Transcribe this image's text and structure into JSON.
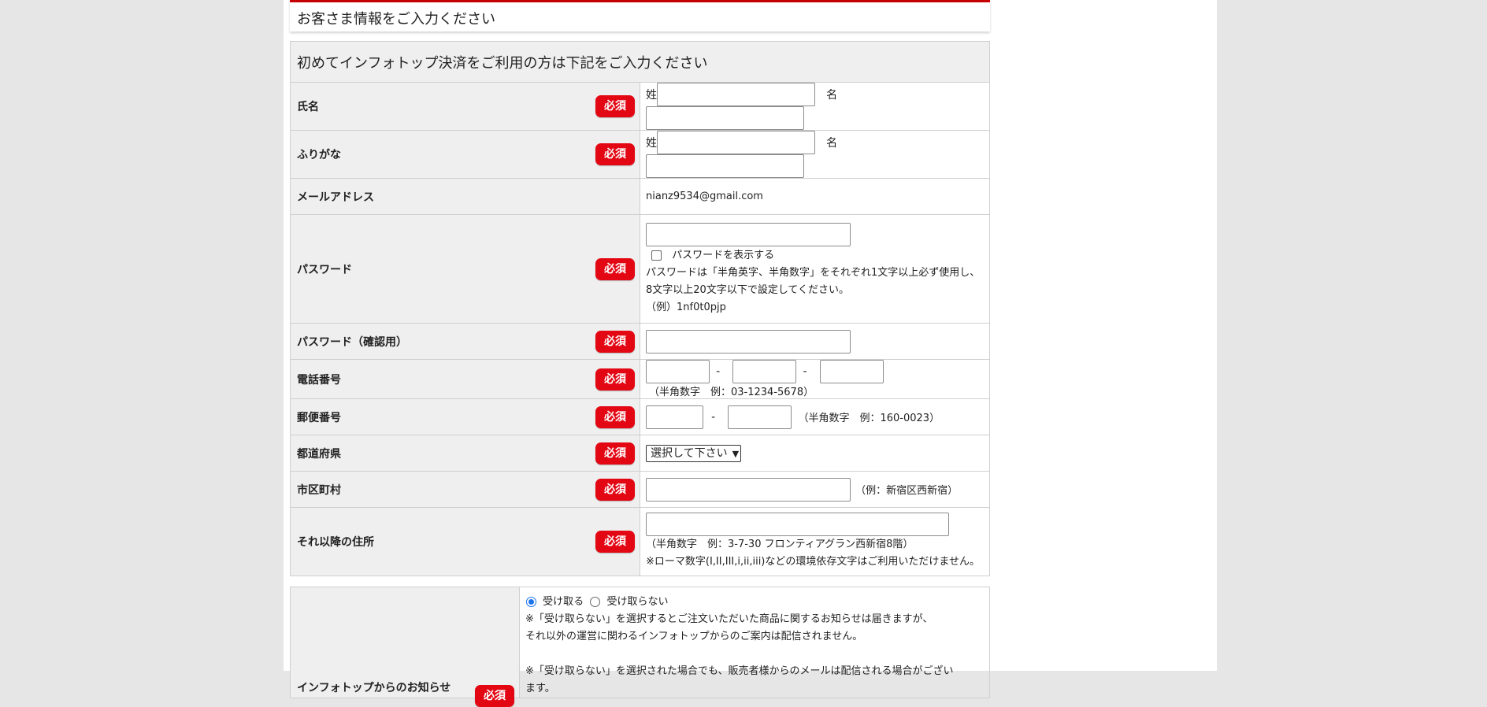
{
  "header": {
    "title": "お客さま情報をご入力ください"
  },
  "form": {
    "caption": "初めてインフォトップ決済をご利用の方は下記をご入力ください",
    "required_badge": "必須",
    "name": {
      "label": "氏名",
      "last_label": "姓",
      "first_label": "名"
    },
    "kana": {
      "label": "ふりがな",
      "last_label": "姓",
      "first_label": "名"
    },
    "email": {
      "label": "メールアドレス",
      "value": "nianz9534@gmail.com"
    },
    "password": {
      "label": "パスワード",
      "show_label": "パスワードを表示する",
      "note1": "パスワードは「半角英字、半角数字」をそれぞれ1文字以上必ず使用し、",
      "note2": "8文字以上20文字以下で設定してください。",
      "example": "（例）1nf0t0pjp"
    },
    "password_confirm": {
      "label": "パスワード（確認用）"
    },
    "phone": {
      "label": "電話番号",
      "sep": "-",
      "hint": "（半角数字　例：03-1234-5678）"
    },
    "postal": {
      "label": "郵便番号",
      "sep": "-",
      "hint": "（半角数字　例：160-0023）"
    },
    "prefecture": {
      "label": "都道府県",
      "selected": "選択して下さい"
    },
    "city": {
      "label": "市区町村",
      "hint": "（例：新宿区西新宿）"
    },
    "address": {
      "label": "それ以降の住所",
      "hint": "（半角数字　例：3-7-30 フロンティアグラン西新宿8階）",
      "note": "※ローマ数字(I,II,III,i,ii,iii)などの環境依存文字はご利用いただけません。"
    }
  },
  "notice": {
    "label": "インフォトップからのお知らせ",
    "accept_label": "受け取る",
    "reject_label": "受け取らない",
    "accept_selected": true,
    "note1": "※「受け取らない」を選択するとご注文いただいた商品に関するお知らせは届きますが、",
    "note2": "それ以外の運営に関わるインフォトップからのご案内は配信されません。",
    "note3": "※「受け取らない」を選択された場合でも、販売者様からのメールは配信される場合がござい",
    "note4": "ます。"
  }
}
